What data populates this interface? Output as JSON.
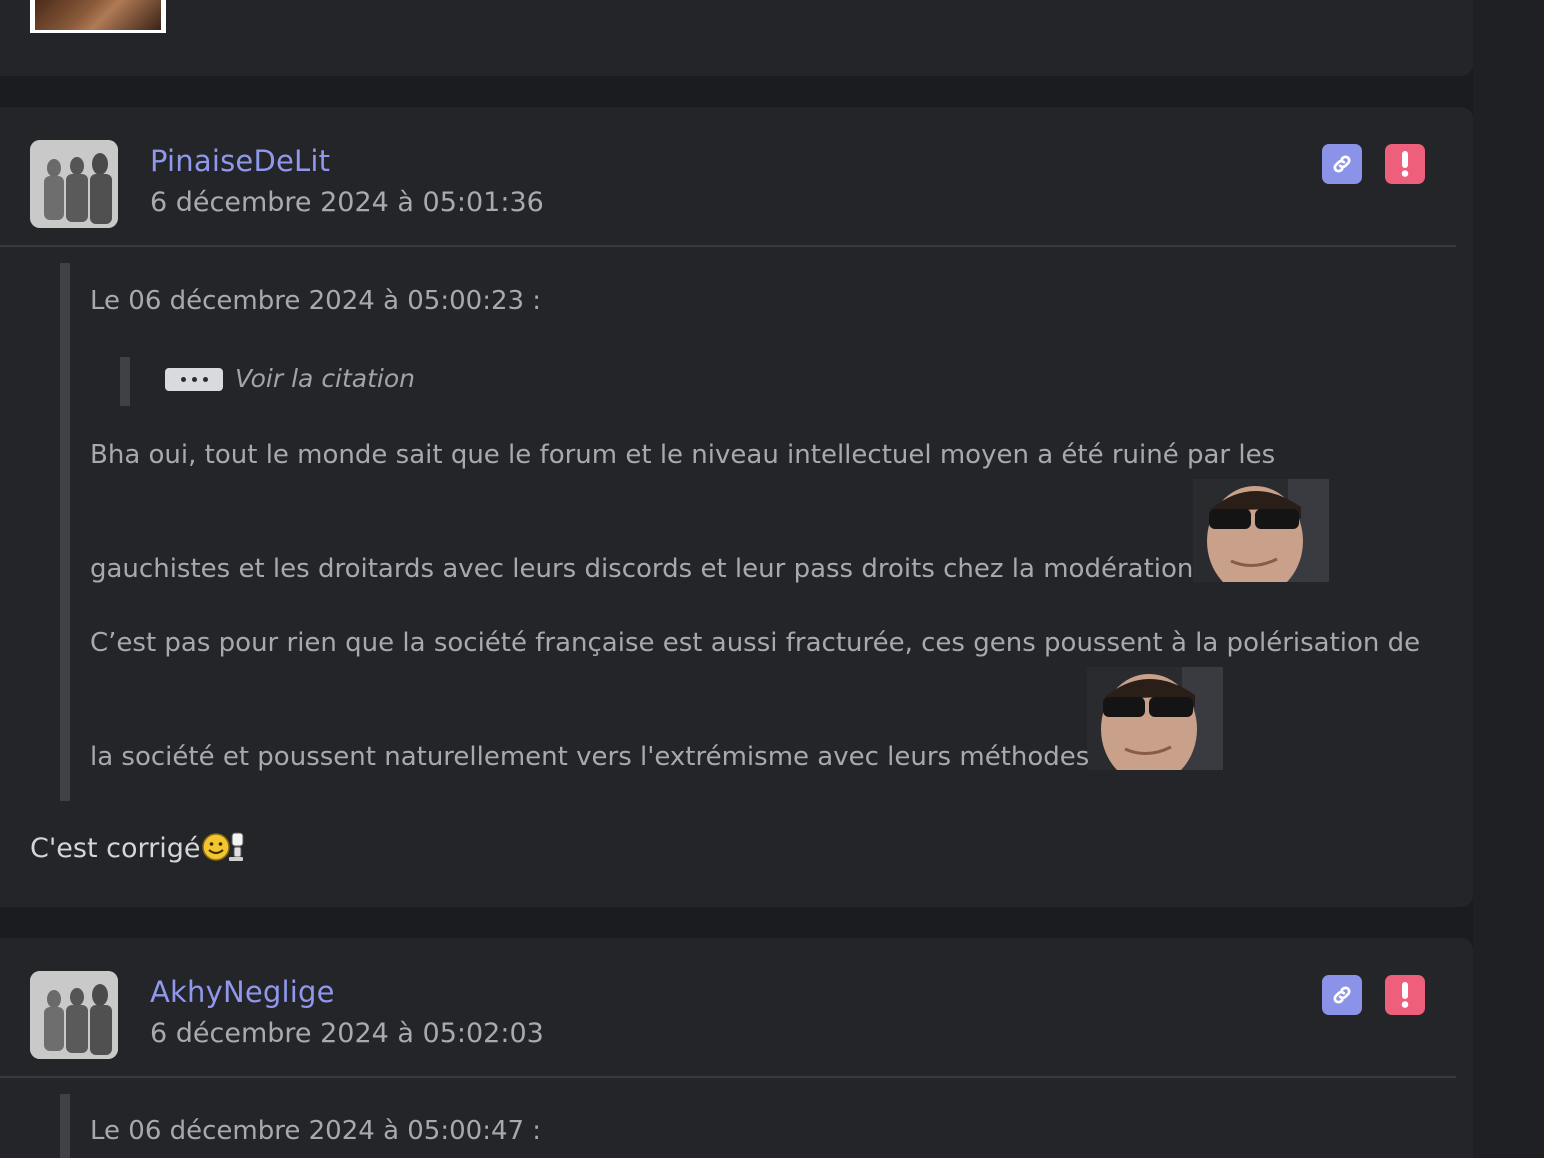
{
  "posts": [
    {
      "username": "PinaiseDeLit",
      "timestamp": "6 décembre 2024 à 05:01:36",
      "quote": {
        "header": "Le 06 décembre 2024 à 05:00:23 :",
        "nested_quote_label": "Voir la citation",
        "lines": [
          "Bha oui, tout le monde sait que le forum et le niveau intellectuel moyen a été ruiné par les",
          "gauchistes et les droitards avec leurs discords et leur pass droits chez la modération",
          "C’est pas pour rien que la société française est aussi fracturée, ces gens poussent à la polérisation de",
          "la société et poussent naturellement vers l'extrémisme avec leurs méthodes"
        ]
      },
      "reply": "C'est corrigé"
    },
    {
      "username": "AkhyNeglige",
      "timestamp": "6 décembre 2024 à 05:02:03",
      "quote": {
        "header": "Le 06 décembre 2024 à 05:00:47 :"
      }
    }
  ],
  "icons": {
    "link": "link-icon",
    "report": "exclamation-icon",
    "ellipsis": "ellipsis-icon",
    "smiley": "smiley-icon"
  },
  "colors": {
    "background": "#1b1c1f",
    "card": "#242528",
    "username": "#8f98ec",
    "link_button": "#8b93e8",
    "report_button": "#ee5f7c"
  }
}
